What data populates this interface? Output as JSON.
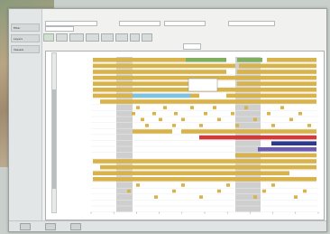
{
  "window": {
    "title": ""
  },
  "left_nav": {
    "items": [
      {
        "label": "Filter"
      },
      {
        "label": "Layers"
      },
      {
        "label": "Vessels"
      }
    ]
  },
  "top_area": {
    "title": ""
  },
  "toolbar": {
    "buttons": [
      {
        "label": "",
        "active": true
      },
      {
        "label": "",
        "active": false
      },
      {
        "label": "",
        "active": false
      },
      {
        "label": "",
        "active": false
      },
      {
        "label": "",
        "active": false
      },
      {
        "label": "",
        "active": false
      },
      {
        "label": "",
        "active": false
      },
      {
        "label": "",
        "active": false
      }
    ]
  },
  "zoom": {
    "value": ""
  },
  "status": {
    "buttons": [
      {
        "label": ""
      },
      {
        "label": ""
      },
      {
        "label": ""
      }
    ]
  },
  "gantt": {
    "colors": {
      "gold": "#d8b24a",
      "green": "#7fae5e",
      "blue": "#7cc3e0",
      "red": "#d23a3a",
      "navy": "#2b3a8f",
      "purple": "#6b5bb3",
      "shade": "#cfcfcf"
    },
    "row_labels": [
      "",
      "",
      "",
      "",
      "",
      "",
      "",
      "",
      "",
      "",
      "",
      "",
      "",
      "",
      "",
      "",
      "",
      "",
      "",
      "",
      "",
      "",
      "",
      "",
      "",
      ""
    ],
    "x_ticks": [
      "",
      "",
      "",
      "",
      "",
      "",
      "",
      "",
      "",
      "",
      ""
    ]
  }
}
